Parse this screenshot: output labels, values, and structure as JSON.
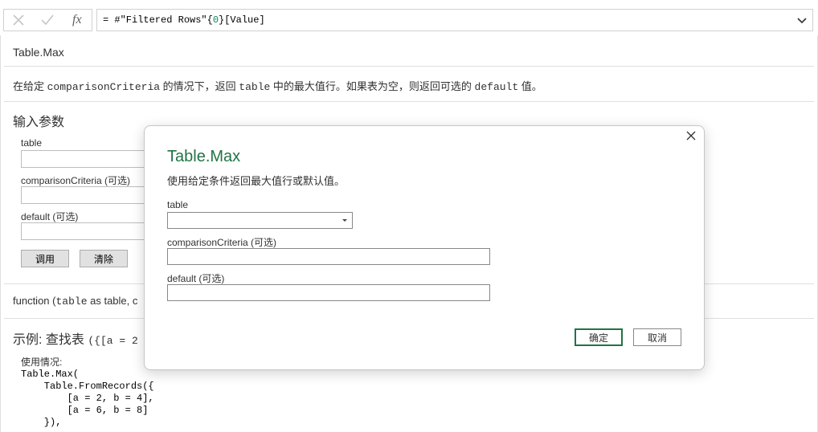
{
  "formula_bar": {
    "cancel_icon": "close-icon",
    "confirm_icon": "checkmark-icon",
    "fx_label": "fx",
    "formula_prefix": "= #\"Filtered Rows\"{",
    "formula_index": "0",
    "formula_suffix": "}[Value]"
  },
  "function_doc": {
    "name": "Table.Max",
    "description_parts": [
      "在给定 ",
      "comparisonCriteria",
      " 的情况下，返回 ",
      "table",
      " 中的最大值行。如果表为空，则返回可选的 ",
      "default",
      " 值。"
    ],
    "params_title": "输入参数",
    "params": [
      {
        "label": "table"
      },
      {
        "label": "comparisonCriteria (可选)"
      },
      {
        "label": "default (可选)"
      }
    ],
    "invoke_label": "调用",
    "clear_label": "清除",
    "signature_prefix": "function (",
    "signature_code": "table",
    "signature_suffix": " as table, c",
    "example_title": "示例: 查找表",
    "example_code": "({[a = 2",
    "usage_label": "使用情况:",
    "usage_code": "Table.Max(\n    Table.FromRecords({\n        [a = 2, b = 4],\n        [a = 6, b = 8]\n    }),"
  },
  "dialog": {
    "close_icon": "close-icon",
    "title": "Table.Max",
    "description": "使用给定条件返回最大值行或默认值。",
    "fields": [
      {
        "label": "table",
        "value": ""
      },
      {
        "label": "comparisonCriteria (可选)",
        "value": ""
      },
      {
        "label": "default (可选)",
        "value": ""
      }
    ],
    "ok_label": "确定",
    "cancel_label": "取消"
  },
  "colors": {
    "accent_green": "#217346",
    "border": "#d2d0ce"
  }
}
